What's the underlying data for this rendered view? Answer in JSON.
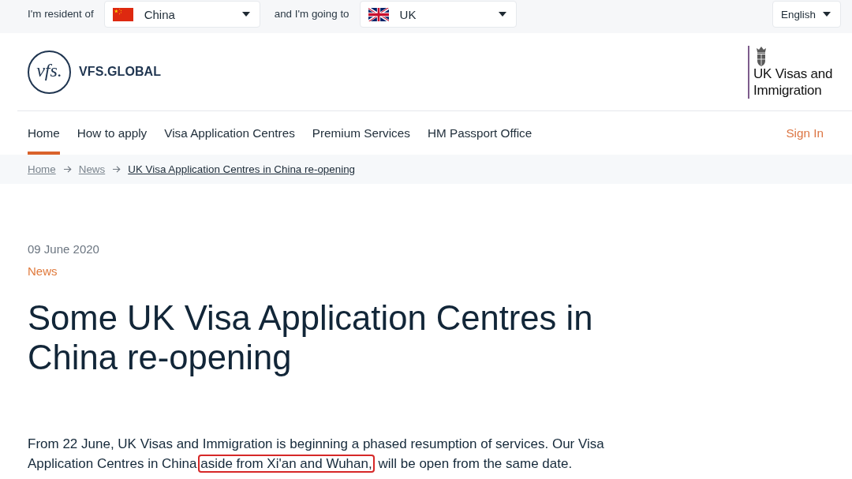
{
  "top_bar": {
    "resident_label": "I'm resident of",
    "resident_select": {
      "value": "China"
    },
    "destination_label": "and I'm going to",
    "destination_select": {
      "value": "UK"
    },
    "language_select": {
      "value": "English"
    }
  },
  "header": {
    "logo_mark": "vfs.",
    "logo_text": "VFS.GLOBAL",
    "partner_text": "UK Visas and Immigration"
  },
  "nav": {
    "items": [
      {
        "label": "Home",
        "selected": true
      },
      {
        "label": "How to apply",
        "selected": false
      },
      {
        "label": "Visa Application Centres",
        "selected": false
      },
      {
        "label": "Premium Services",
        "selected": false
      },
      {
        "label": "HM Passport Office",
        "selected": false
      }
    ],
    "sign_in": "Sign In"
  },
  "breadcrumb": [
    {
      "label": "Home",
      "current": false
    },
    {
      "label": "News",
      "current": false
    },
    {
      "label": "UK Visa Application Centres in China re-opening",
      "current": true
    }
  ],
  "article": {
    "date": "09 June 2020",
    "category": "News",
    "title": "Some UK Visa Application Centres in China re-opening",
    "paragraph": [
      {
        "text": "From 22 June, UK Visas and Immigration is beginning a phased resumption of services. Our Visa Application Centres in China",
        "highlighted": false
      },
      {
        "text": "aside from Xi'an and Wuhan,",
        "highlighted": true
      },
      {
        "text": "will be open from the same date.",
        "highlighted": false
      }
    ]
  }
}
